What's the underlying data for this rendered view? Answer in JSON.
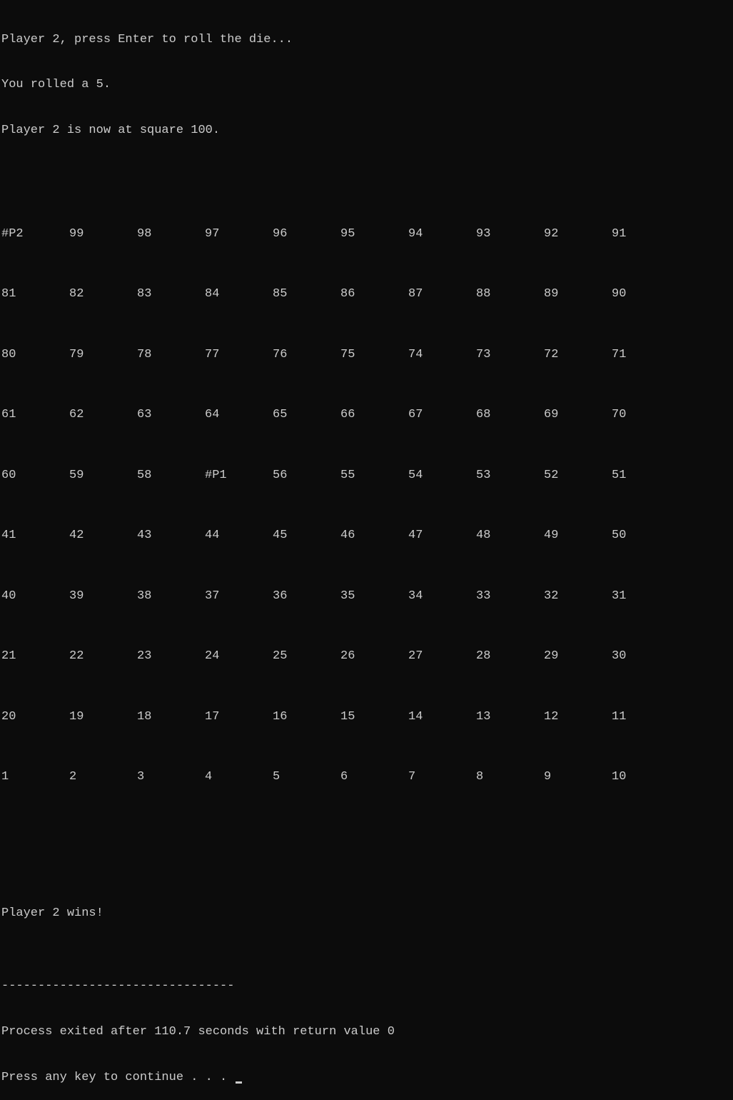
{
  "messages": {
    "prompt": "Player 2, press Enter to roll the die...",
    "roll_result": "You rolled a 5.",
    "position_update": "Player 2 is now at square 100."
  },
  "board": [
    [
      "#P2",
      "99",
      "98",
      "97",
      "96",
      "95",
      "94",
      "93",
      "92",
      "91"
    ],
    [
      "81",
      "82",
      "83",
      "84",
      "85",
      "86",
      "87",
      "88",
      "89",
      "90"
    ],
    [
      "80",
      "79",
      "78",
      "77",
      "76",
      "75",
      "74",
      "73",
      "72",
      "71"
    ],
    [
      "61",
      "62",
      "63",
      "64",
      "65",
      "66",
      "67",
      "68",
      "69",
      "70"
    ],
    [
      "60",
      "59",
      "58",
      "#P1",
      "56",
      "55",
      "54",
      "53",
      "52",
      "51"
    ],
    [
      "41",
      "42",
      "43",
      "44",
      "45",
      "46",
      "47",
      "48",
      "49",
      "50"
    ],
    [
      "40",
      "39",
      "38",
      "37",
      "36",
      "35",
      "34",
      "33",
      "32",
      "31"
    ],
    [
      "21",
      "22",
      "23",
      "24",
      "25",
      "26",
      "27",
      "28",
      "29",
      "30"
    ],
    [
      "20",
      "19",
      "18",
      "17",
      "16",
      "15",
      "14",
      "13",
      "12",
      "11"
    ],
    [
      "1",
      "2",
      "3",
      "4",
      "5",
      "6",
      "7",
      "8",
      "9",
      "10"
    ]
  ],
  "win_message": "Player 2 wins!",
  "separator": "--------------------------------",
  "process_exit": "Process exited after 110.7 seconds with return value 0",
  "continue_prompt": "Press any key to continue . . . "
}
